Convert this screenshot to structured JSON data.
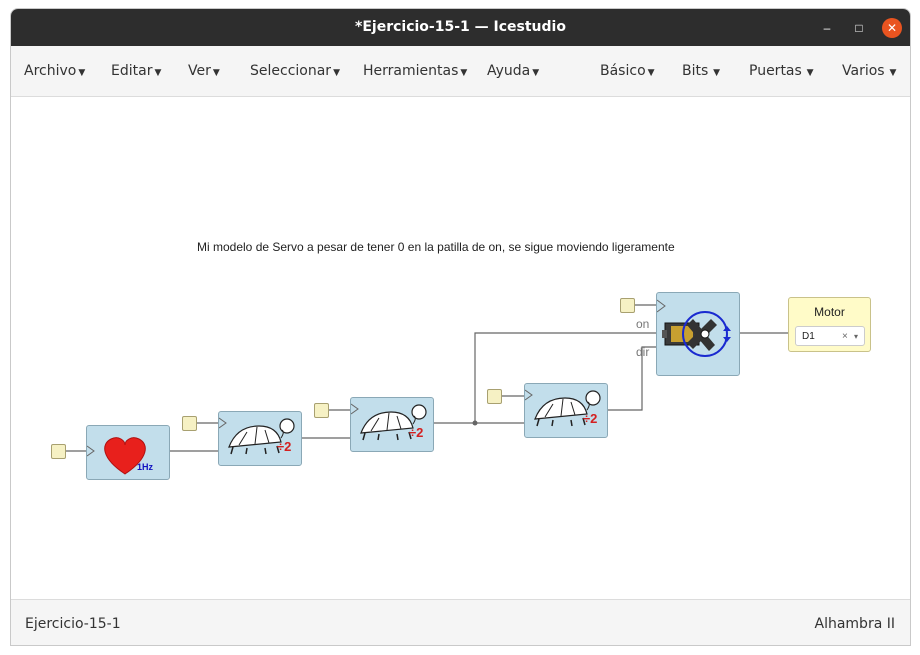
{
  "window": {
    "title": "*Ejercicio-15-1 — Icestudio",
    "minimize_glyph": "–",
    "maximize_glyph": "□",
    "close_glyph": "✕"
  },
  "menu": {
    "left": [
      "Archivo",
      "Editar",
      "Ver",
      "Seleccionar",
      "Herramientas",
      "Ayuda"
    ],
    "right": [
      "Básico",
      "Bits",
      "Puertas",
      "Varios"
    ]
  },
  "canvas": {
    "comment": "Mi modelo de Servo a pesar de tener 0 en la patilla de on, se sigue moviendo ligeramente",
    "blocks": {
      "heart": {
        "label": "1Hz",
        "icon": "heart-icon"
      },
      "divider1": {
        "label": "÷2",
        "icon": "turtle-icon"
      },
      "divider2": {
        "label": "÷2",
        "icon": "turtle-icon"
      },
      "divider3": {
        "label": "÷2",
        "icon": "turtle-icon"
      },
      "servo": {
        "ports": [
          "on",
          "dir"
        ],
        "icon": "servo-icon"
      }
    },
    "output": {
      "name": "Motor",
      "pin_value": "D1",
      "clear_glyph": "×",
      "dropdown_glyph": "▾"
    }
  },
  "status": {
    "left": "Ejercicio-15-1",
    "right": "Alhambra II"
  },
  "colors": {
    "titlebar": "#2d2d2d",
    "close_button": "#e95420",
    "block_fill": "#c2deeb",
    "output_fill": "#fffbc8",
    "heart": "#e8201c",
    "divider_label": "#d42020"
  }
}
